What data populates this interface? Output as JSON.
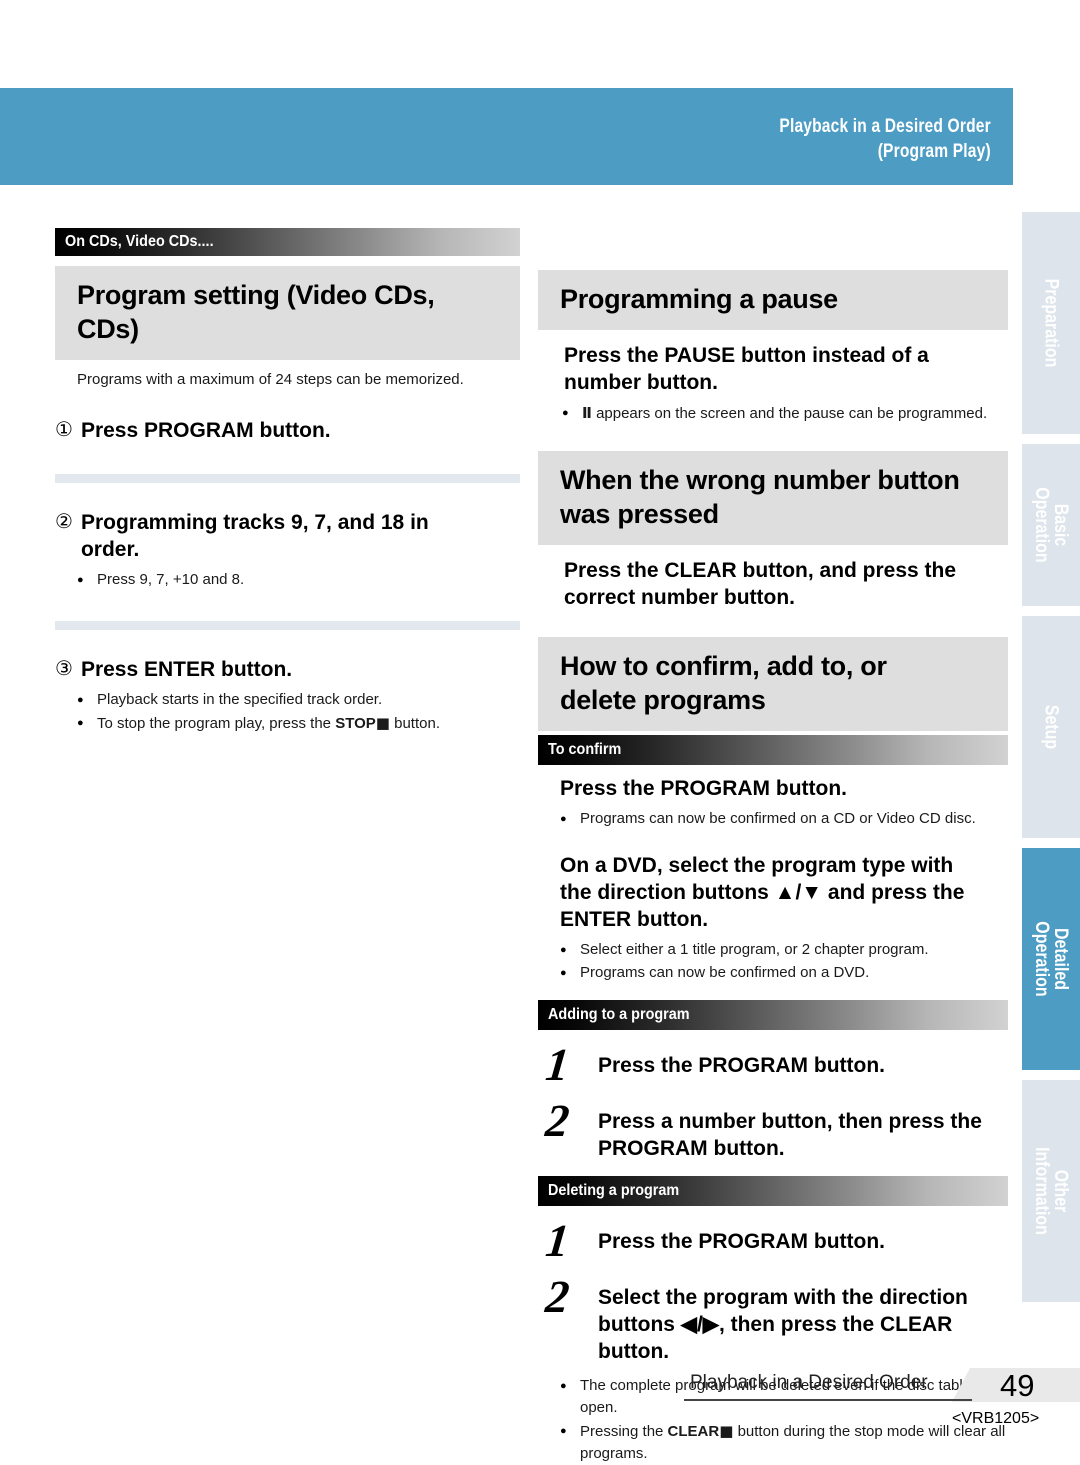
{
  "header": {
    "title": "Playback in a Desired Order\n(Program Play)"
  },
  "side_tabs": [
    {
      "label": "Preparation",
      "active": false
    },
    {
      "label": "Basic\nOperation",
      "active": false
    },
    {
      "label": "Setup",
      "active": false
    },
    {
      "label": "Detailed\nOperation",
      "active": true
    },
    {
      "label": "Other\nInformation",
      "active": false
    }
  ],
  "left_column": {
    "band_label": "On CDs, Video CDs....",
    "heading": "Program setting (Video CDs,\nCDs)",
    "intro": "Programs with a maximum of 24 steps can be memorized.",
    "step1_num": "①",
    "step1_text": "Press PROGRAM button.",
    "step2_num": "②",
    "step2_text": "Programming tracks 9, 7, and 18 in\norder.",
    "step2_bullet": "Press 9, 7, +10 and 8.",
    "step3_num": "③",
    "step3_text": "Press ENTER button.",
    "step3_bullet1": "Playback starts in the specified track order.",
    "step3_bullet2_a": "To stop the program play, press the ",
    "step3_bullet2_b": "STOP",
    "step3_bullet2_icon": "■",
    "step3_bullet2_c": " button."
  },
  "right_column": {
    "pause_heading": "Programming a pause",
    "pause_instruction": "Press the PAUSE button instead of a\nnumber button.",
    "pause_bullet_icon": "Ⅱ",
    "pause_bullet_text": "appears on the screen and the pause can be programmed.",
    "wrong_heading": "When the wrong number button\nwas pressed",
    "wrong_instruction": "Press the CLEAR button, and press the\ncorrect number button.",
    "confirm_heading": "How to confirm, add to, or\ndelete programs",
    "confirm_band": "To confirm",
    "confirm_instruction": "Press the PROGRAM button.",
    "confirm_bullet": "Programs can now be confirmed on a CD or Video CD disc.",
    "dvd_instruction": "On a DVD, select the program type with\nthe direction buttons ▲/▼ and press the\nENTER button.",
    "dvd_bullet1": "Select either a 1 title program, or 2 chapter program.",
    "dvd_bullet2": "Programs can now be confirmed on a DVD.",
    "adding_band": "Adding to a program",
    "adding_step1_num": "1",
    "adding_step1_text": "Press the PROGRAM button.",
    "adding_step2_num": "2",
    "adding_step2_text": "Press a number button, then press the\nPROGRAM button.",
    "deleting_band": "Deleting a program",
    "deleting_step1_num": "1",
    "deleting_step1_text": "Press the PROGRAM button.",
    "deleting_step2_num": "2",
    "deleting_step2_text": "Select the program with the direction\nbuttons ◀/▶, then press the CLEAR\nbutton.",
    "deleting_bullet1": "The complete program will be deleted even if the disc table is open.",
    "deleting_bullet2_a": "Pressing the ",
    "deleting_bullet2_b": "CLEAR",
    "deleting_bullet2_icon": "■",
    "deleting_bullet2_c": " button during the stop mode will clear all programs."
  },
  "footer": {
    "section": "Playback in a Desired Order",
    "page_number": "49",
    "doc_code": "<VRB1205>"
  },
  "colors": {
    "accent_blue": "#4d9cc4",
    "tab_inactive": "#dde4eb",
    "heading_gray": "#dedede",
    "divider_blue": "#e2e8ee"
  }
}
